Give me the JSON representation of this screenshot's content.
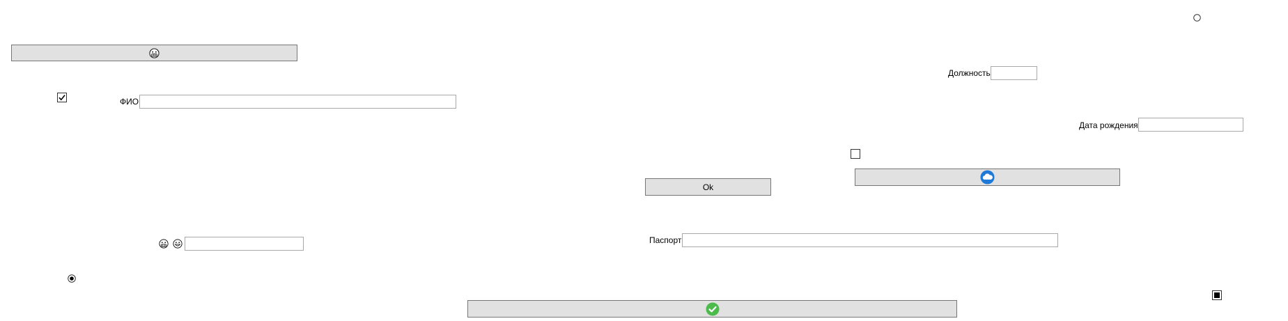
{
  "labels": {
    "fio": "ФИО",
    "position": "Должность",
    "birth_date": "Дата рождения",
    "passport": "Паспорт"
  },
  "buttons": {
    "ok": "Ok"
  },
  "fields": {
    "fio": "",
    "position": "",
    "birth_date": "",
    "passport": "",
    "emoji_field": ""
  },
  "icons": {
    "top_button": "grimace-face-icon",
    "cloud_button": "cloud-icon",
    "bottom_button": "check-circle-icon",
    "face_a": "grimace-face-icon",
    "face_b": "grin-face-icon"
  },
  "controls": {
    "checkbox_top_checked": true,
    "checkbox_mid_checked": false,
    "radio_top_selected": false,
    "radio_bottom_selected": true,
    "checkbox_bottom_indeterminate": true
  },
  "colors": {
    "button_bg": "#e1e1e1",
    "check_green": "#4cbb4c",
    "cloud_blue": "#1e7ad6"
  }
}
